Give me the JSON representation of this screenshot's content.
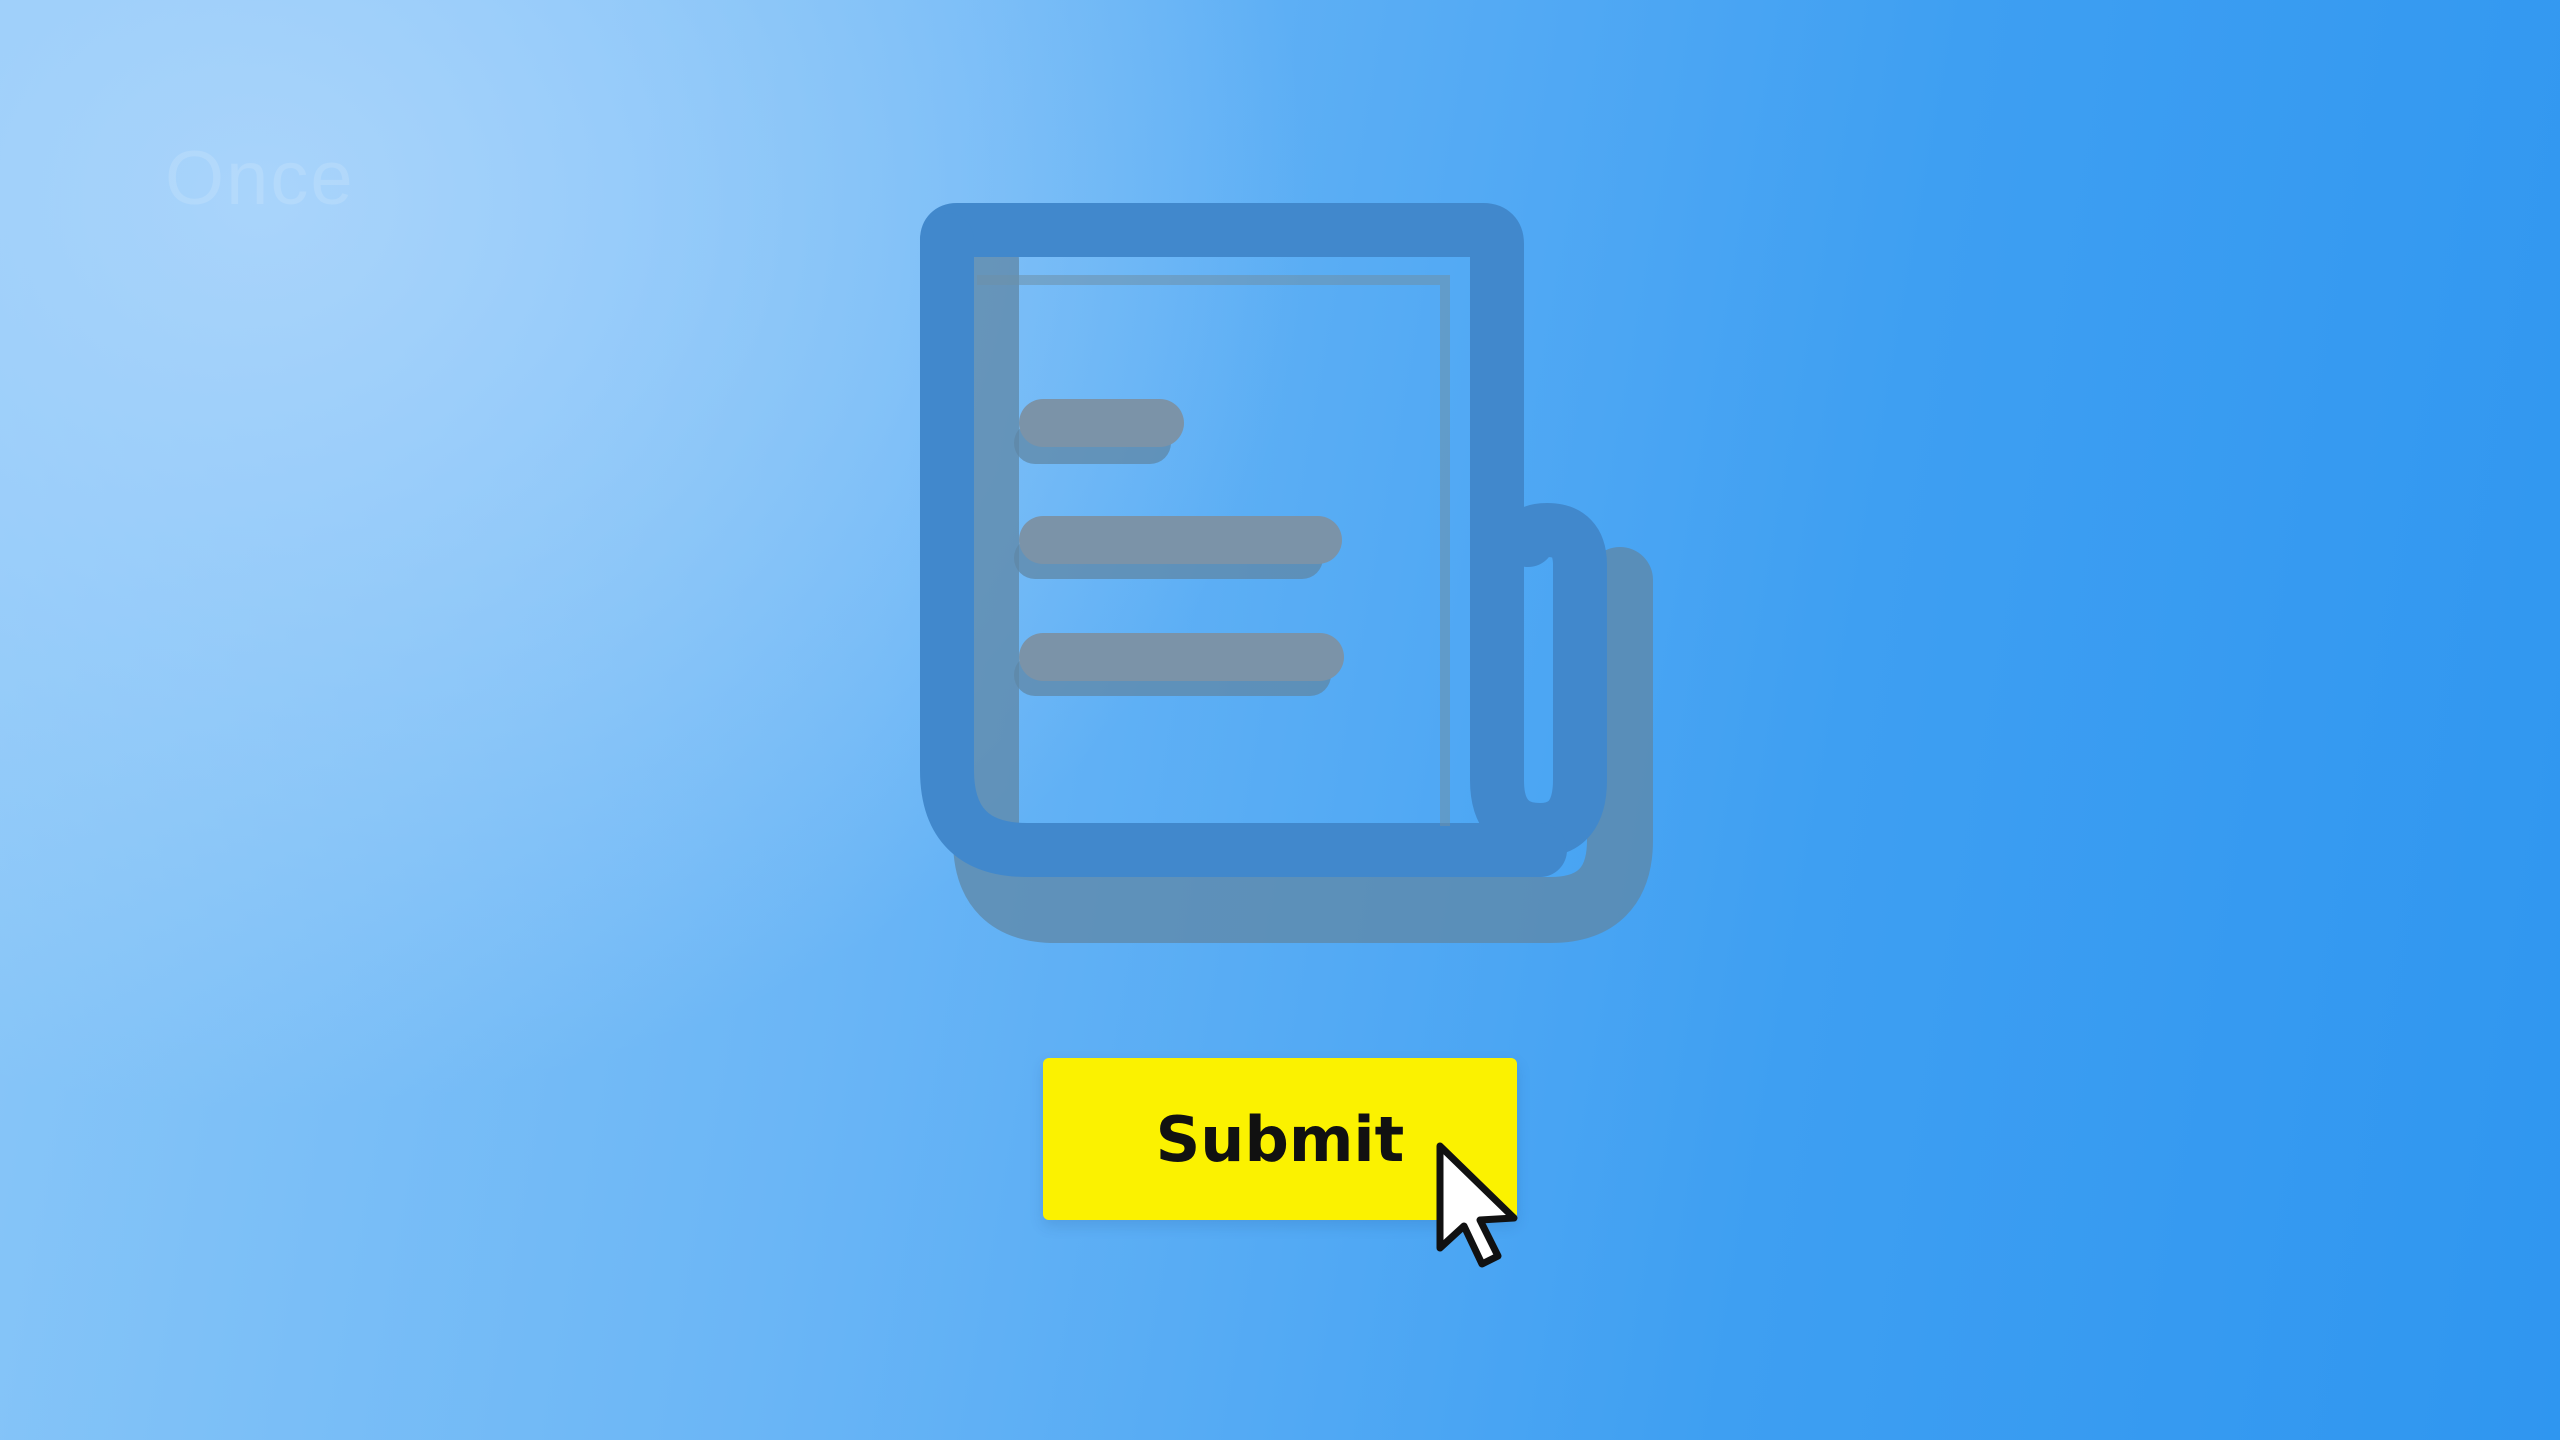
{
  "caption": {
    "text": "Once"
  },
  "form": {
    "icon": "newspaper-document-icon",
    "submit_label": "Submit"
  },
  "pointer": {
    "icon": "mouse-pointer-icon"
  },
  "colors": {
    "background_light": "#a9d4fb",
    "background_dark": "#2f96f0",
    "icon_blue": "#4188cc",
    "icon_lines": "#7b93a8",
    "button_yellow": "#fbf200",
    "button_text": "#111111"
  }
}
